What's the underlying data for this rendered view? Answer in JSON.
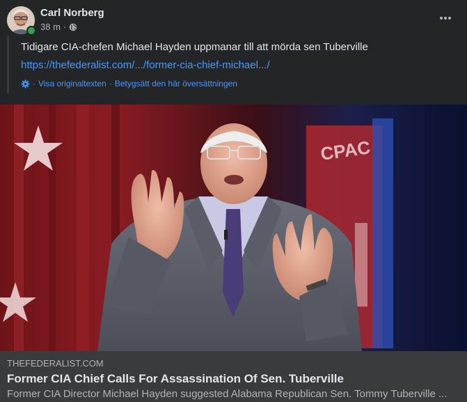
{
  "post": {
    "author": "Carl Norberg",
    "time": "38 m",
    "separator": "·",
    "privacy_icon": "globe-icon",
    "more_icon": "more-horizontal-icon"
  },
  "shared_text": {
    "text": "Tidigare CIA-chefen Michael Hayden uppmanar till att mörda sen Tuberville",
    "link": "https://thefederalist.com/.../former-cia-chief-michael.../",
    "translation_icon": "gear-icon",
    "separator": "·",
    "show_original": "Visa originaltexten",
    "rate_translation": "Betygsätt den här översättningen"
  },
  "link_preview": {
    "domain": "THEFEDERALIST.COM",
    "title": "Former CIA Chief Calls For Assassination Of Sen. Tuberville",
    "description": "Former CIA Director Michael Hayden suggested Alabama Republican Sen. Tommy Tuberville ..."
  },
  "colors": {
    "background": "#242526",
    "card": "#3a3b3c",
    "link": "#4599ff",
    "online": "#31a24c"
  }
}
